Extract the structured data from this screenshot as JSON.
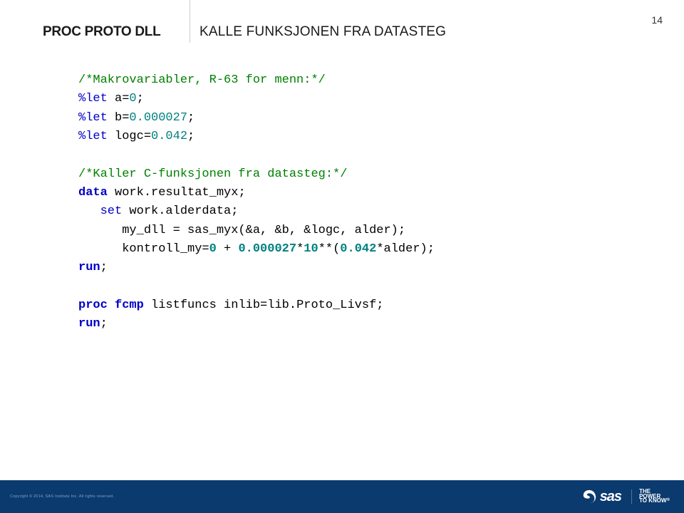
{
  "page_number": "14",
  "header": {
    "left": "PROC PROTO DLL",
    "right": "KALLE FUNKSJONEN FRA DATASTEG"
  },
  "code": {
    "c1": "/*Makrovariabler, R-63 for menn:*/",
    "l1a": "%let",
    "l1b": " a=",
    "l1c": "0",
    "l1d": ";",
    "l2a": "%let",
    "l2b": " b=",
    "l2c": "0.000027",
    "l2d": ";",
    "l3a": "%let",
    "l3b": " logc=",
    "l3c": "0.042",
    "l3d": ";",
    "c2": "/*Kaller C-funksjonen fra datasteg:*/",
    "d1a": "data",
    "d1b": " work.resultat_myx;",
    "s1a": "set",
    "s1b": " work.alderdata;",
    "m1a": "      my_dll = sas_myx(&a, &b, &logc, alder);",
    "k1a": "      kontroll_my=",
    "k1b": "0",
    "k1c": " + ",
    "k1d": "0.000027",
    "k1e": "*",
    "k1f": "10",
    "k1g": "**(",
    "k1h": "0.042",
    "k1i": "*alder);",
    "r1": "run",
    "r1b": ";",
    "p1a": "proc",
    "p1b": " ",
    "p1c": "fcmp",
    "p1d": " listfuncs inlib=lib.Proto_Livsf;",
    "r2": "run",
    "r2b": ";"
  },
  "footer": {
    "copyright": "Copyright © 2014, SAS Institute Inc. All rights reserved.",
    "brand": "sas",
    "tag1": "THE",
    "tag2": "POWER",
    "tag3": "TO KNOW"
  }
}
